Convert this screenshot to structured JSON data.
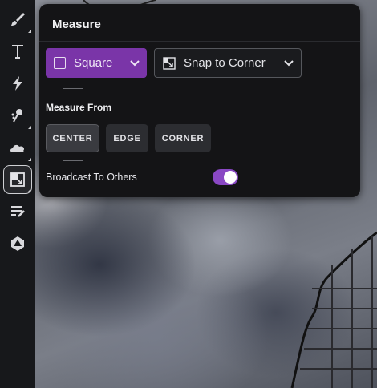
{
  "panel": {
    "title": "Measure",
    "shape_select": {
      "value": "Square"
    },
    "snap_select": {
      "value": "Snap to Corner"
    },
    "measure_from": {
      "label": "Measure From",
      "options": [
        "CENTER",
        "EDGE",
        "CORNER"
      ],
      "selected": "CENTER"
    },
    "broadcast": {
      "label": "Broadcast To Others",
      "enabled": true
    }
  },
  "toolbar": {
    "tools": [
      "brush-icon",
      "text-icon",
      "lightning-icon",
      "pin-icon",
      "cloud-icon",
      "measure-icon",
      "notes-icon",
      "dice-icon"
    ],
    "active": "measure-icon"
  },
  "colors": {
    "accent": "#7a35a8",
    "toggle_on": "#8a48c4",
    "panel_bg": "#141416",
    "toolbar_bg": "#17181b"
  }
}
